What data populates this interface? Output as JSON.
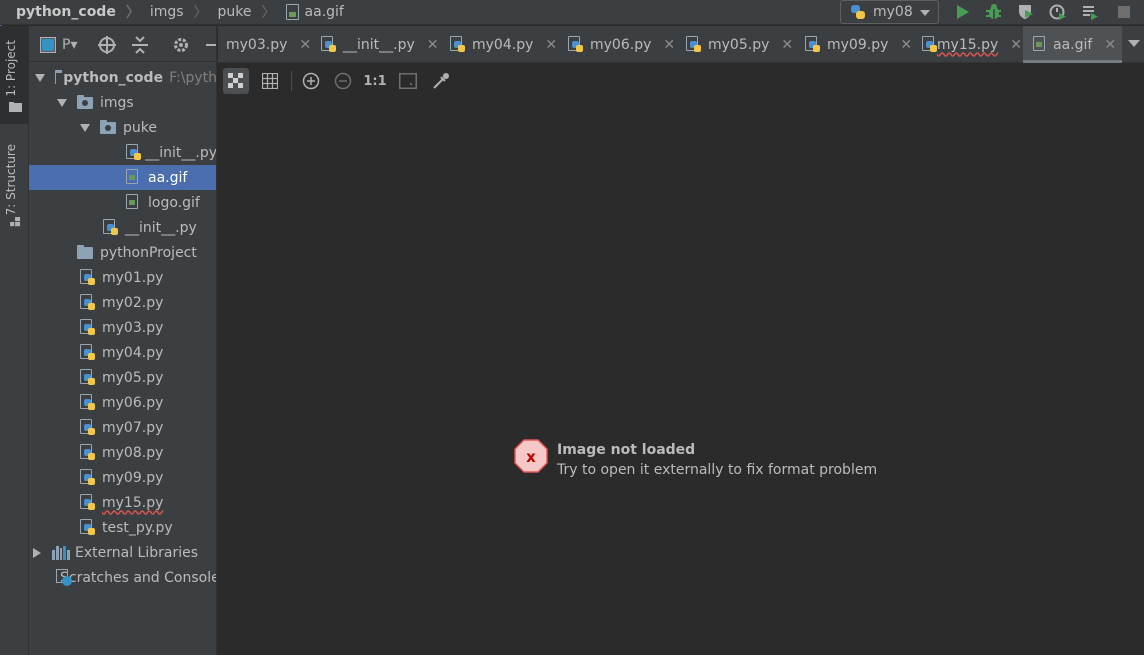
{
  "breadcrumbs": {
    "root": "python_code",
    "folder1": "imgs",
    "folder2": "puke",
    "file": "aa.gif"
  },
  "run_config": {
    "label": "my08"
  },
  "icons": {
    "run": "play-icon",
    "debug": "bug-icon",
    "coverage": "shield-icon",
    "profile": "profiler-icon",
    "build": "build-icon",
    "stop": "stop-icon"
  },
  "left_stripe": {
    "project_tab": "1: Project",
    "structure_tab": "7: Structure"
  },
  "project_panel": {
    "view_selector": "P▾",
    "tree": [
      {
        "label": "python_code",
        "hint": "F:\\pyth",
        "type": "root"
      },
      {
        "label": "imgs",
        "type": "pkg"
      },
      {
        "label": "puke",
        "type": "pkg"
      },
      {
        "label": "__init__.py",
        "type": "py"
      },
      {
        "label": "aa.gif",
        "type": "gif"
      },
      {
        "label": "logo.gif",
        "type": "gif"
      },
      {
        "label": "__init__.py",
        "type": "py"
      },
      {
        "label": "pythonProject",
        "type": "folder"
      },
      {
        "label": "my01.py",
        "type": "py"
      },
      {
        "label": "my02.py",
        "type": "py"
      },
      {
        "label": "my03.py",
        "type": "py"
      },
      {
        "label": "my04.py",
        "type": "py"
      },
      {
        "label": "my05.py",
        "type": "py"
      },
      {
        "label": "my06.py",
        "type": "py"
      },
      {
        "label": "my07.py",
        "type": "py"
      },
      {
        "label": "my08.py",
        "type": "py"
      },
      {
        "label": "my09.py",
        "type": "py"
      },
      {
        "label": "my15.py",
        "type": "py"
      },
      {
        "label": "test_py.py",
        "type": "py"
      },
      {
        "label": "External Libraries",
        "type": "lib"
      },
      {
        "label": "Scratches and Consoles",
        "type": "scratch"
      }
    ]
  },
  "tabs": [
    {
      "label": "my03.py"
    },
    {
      "label": "__init__.py"
    },
    {
      "label": "my04.py"
    },
    {
      "label": "my06.py"
    },
    {
      "label": "my05.py"
    },
    {
      "label": "my09.py"
    },
    {
      "label": "my15.py"
    },
    {
      "label": "aa.gif"
    }
  ],
  "image_toolbar": {
    "actual_size": "1:1"
  },
  "error": {
    "icon": "error-x-icon",
    "title": "Image not loaded",
    "message": "Try to open it externally to fix format problem"
  },
  "colors": {
    "background": "#2b2b2b",
    "panel": "#3c3f41",
    "selection": "#4b6eaf",
    "run_green": "#499c54",
    "error_red": "#e05555"
  }
}
